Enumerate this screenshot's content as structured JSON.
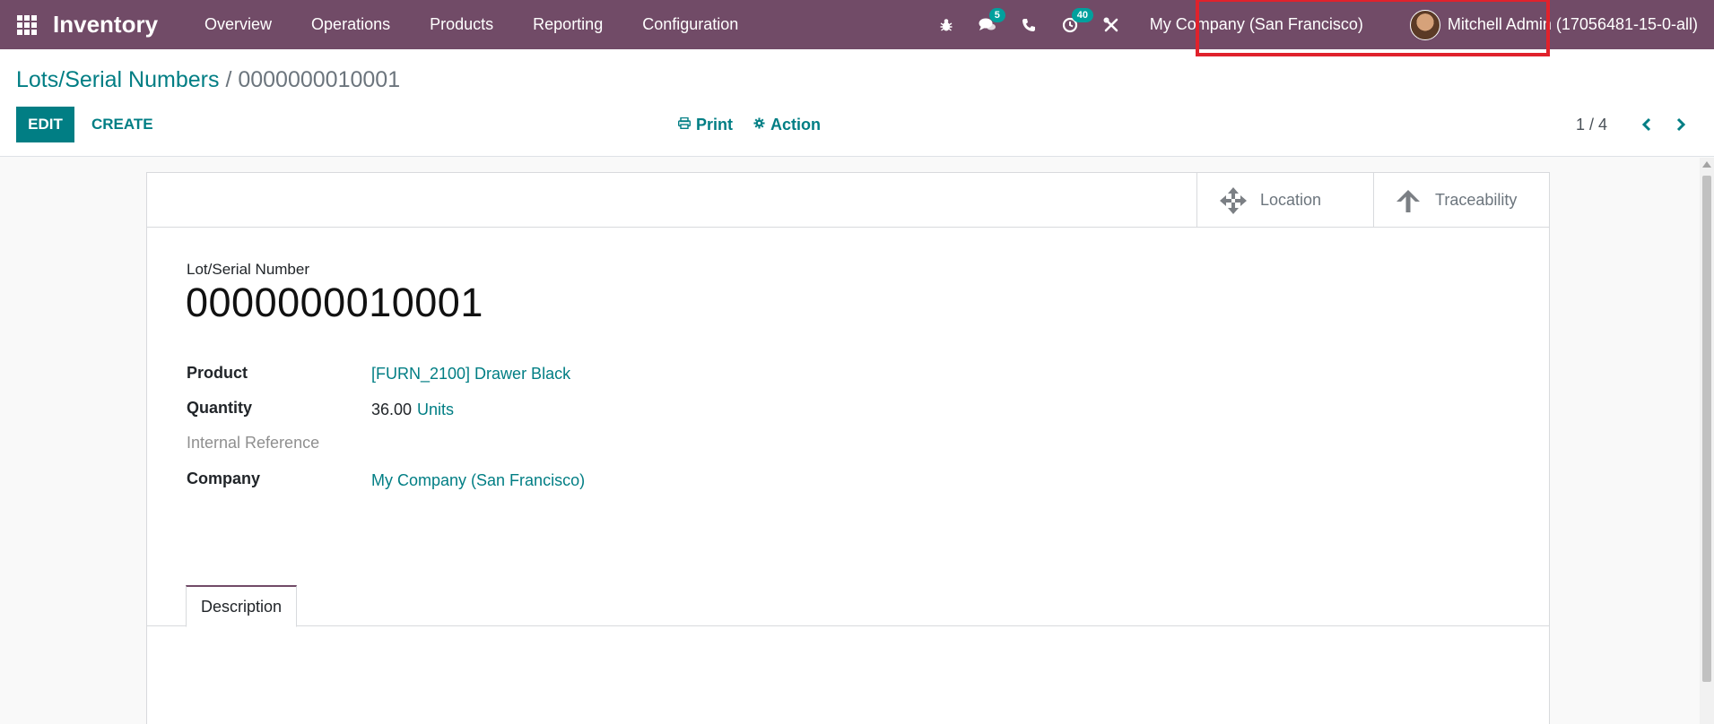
{
  "navbar": {
    "app_name": "Inventory",
    "menu": [
      "Overview",
      "Operations",
      "Products",
      "Reporting",
      "Configuration"
    ],
    "chat_badge": "5",
    "activity_badge": "40",
    "company": "My Company (San Francisco)",
    "user": "Mitchell Admin (17056481-15-0-all)",
    "bg_color": "#714b67"
  },
  "breadcrumb": {
    "parent": "Lots/Serial Numbers",
    "separator": "/",
    "current": "0000000010001"
  },
  "buttons": {
    "edit": "EDIT",
    "create": "CREATE",
    "print": "Print",
    "action": "Action"
  },
  "pager": {
    "value": "1 / 4"
  },
  "smart_buttons": {
    "location": "Location",
    "traceability": "Traceability"
  },
  "form": {
    "name_label": "Lot/Serial Number",
    "name": "0000000010001",
    "fields": {
      "product_label": "Product",
      "product_value": "[FURN_2100] Drawer Black",
      "quantity_label": "Quantity",
      "quantity_value": "36.00",
      "quantity_uom": "Units",
      "internal_ref_label": "Internal Reference",
      "company_label": "Company",
      "company_value": "My Company (San Francisco)"
    },
    "tabs": [
      "Description"
    ]
  },
  "colors": {
    "primary": "#017e84",
    "highlight": "#e0222c"
  }
}
